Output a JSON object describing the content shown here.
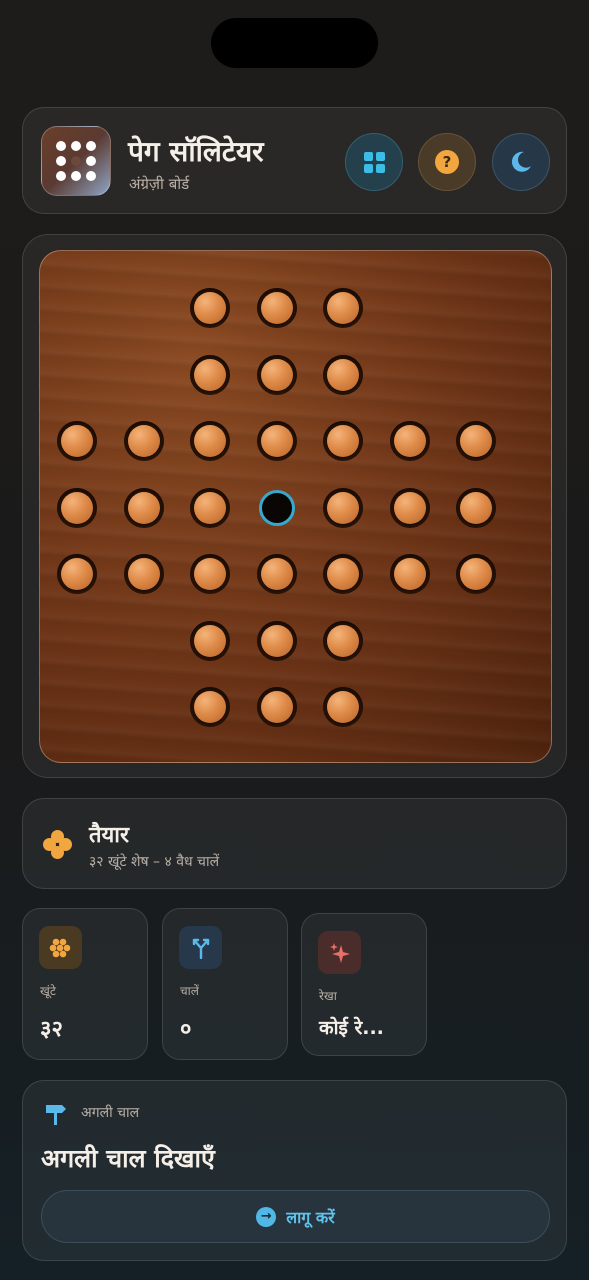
{
  "header": {
    "title": "पेग सॉलिटेयर",
    "subtitle": "अंग्रेज़ी बोर्ड",
    "buttons": [
      "grid-icon",
      "help-icon",
      "moon-icon"
    ],
    "help_glyph": "?"
  },
  "board": {
    "layout": "english",
    "empty_hole": [
      3,
      3
    ],
    "rows": [
      "  OOO  ",
      "  OOO  ",
      "OOOOOOO",
      "OOO.OOO",
      "OOOOOOO",
      "  OOO  ",
      "  OOO  "
    ],
    "peg_color": "#de8a48",
    "empty_ring_color": "#36a9cf"
  },
  "status": {
    "title": "तैयार",
    "subtitle": "३२ खूंटे शेष – ४ वैध चालें",
    "accent": "#f2a640"
  },
  "stats": [
    {
      "icon": "pegs-icon",
      "label": "खूंटे",
      "value": "३२"
    },
    {
      "icon": "moves-icon",
      "label": "चालें",
      "value": "०"
    },
    {
      "icon": "sparkle-icon",
      "label": "रेखा",
      "value": "कोई रे..."
    }
  ],
  "next_move": {
    "label": "अगली चाल",
    "title": "अगली चाल दिखाएँ",
    "button_label": "लागू करें",
    "button_glyph": "→",
    "accent": "#5fc3ec"
  }
}
